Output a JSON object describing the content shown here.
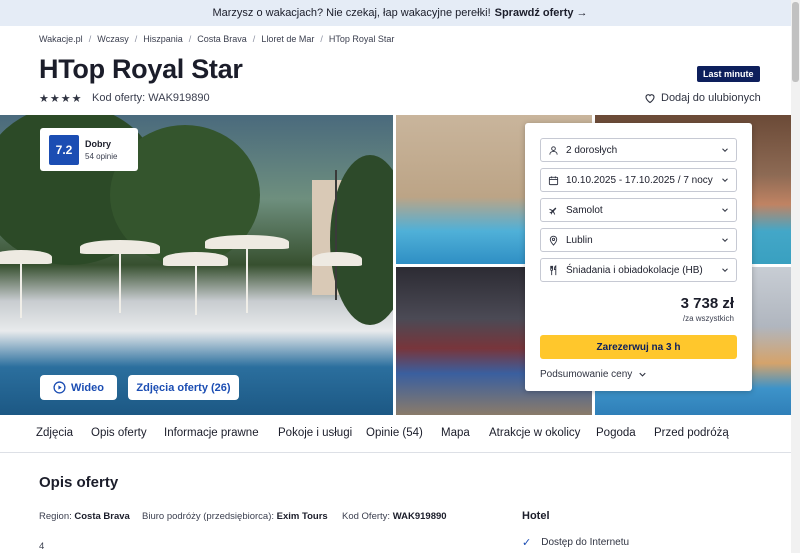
{
  "promo": {
    "text": "Marzysz o wakacjach?⁣ Nie czekaj, łap wakacyjne perełki!⁣",
    "link": "Sprawdź oferty →"
  },
  "breadcrumbs": [
    "Wakacje.pl",
    "Wczasy",
    "Hiszpania",
    "Costa Brava",
    "Lloret de Mar",
    "HTop Royal Star"
  ],
  "hotel": {
    "name": "HTop Royal Star",
    "badge": "Last minute",
    "stars": 4,
    "code_label": "Kod oferty: WAK919890",
    "favorite_label": "Dodaj do ulubionych"
  },
  "rating": {
    "score": "7.2",
    "label": "Dobry",
    "count": "54 opinie"
  },
  "gallery": {
    "video_label": "Wideo",
    "photos_label": "Zdjęcia oferty (26)"
  },
  "booking": {
    "fields": [
      {
        "icon": "person-icon",
        "value": "2 dorosłych"
      },
      {
        "icon": "calendar-icon",
        "value": "10.10.2025 - 17.10.2025 / 7 nocy"
      },
      {
        "icon": "plane-icon",
        "value": "Samolot"
      },
      {
        "icon": "location-pin-icon",
        "value": "Lublin"
      },
      {
        "icon": "cutlery-icon",
        "value": "Śniadania i obiadokolacje (HB)"
      }
    ],
    "price": "3 738 zł",
    "price_note": "/za wszystkich",
    "reserve_label": "Zarezerwuj na 3 h",
    "summary_label": "Podsumowanie ceny"
  },
  "tabs": [
    "Zdjęcia",
    "Opis oferty",
    "Informacje prawne",
    "Pokoje i usługi",
    "Opinie (54)",
    "Mapa",
    "Atrakcje w okolicy",
    "Pogoda",
    "Przed podróżą"
  ],
  "description": {
    "title": "Opis oferty",
    "region_label": "Region:",
    "region_value": "Costa Brava",
    "agency_label": "Biuro podróży (przedsiębiorca):",
    "agency_value": "Exim Tours",
    "code_label": "Kod Oferty:",
    "code_value": "WAK919890",
    "stars_text": "4"
  },
  "hotel_section": {
    "title": "Hotel",
    "features": [
      "Dostęp do Internetu"
    ]
  },
  "colors": {
    "accent": "#1b4db3",
    "cta": "#ffc72c",
    "badge": "#0d1f5c",
    "promo_bg": "#e5ecf6"
  }
}
